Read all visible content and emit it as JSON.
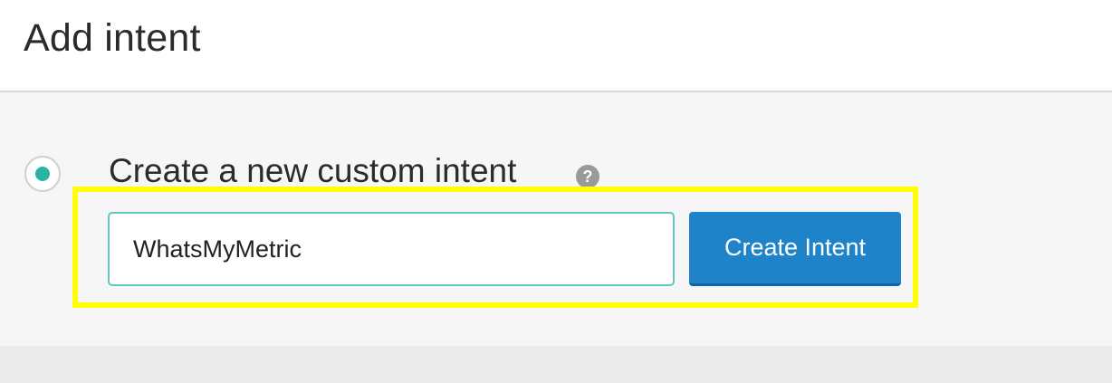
{
  "header": {
    "title": "Add intent"
  },
  "intent_option": {
    "label": "Create a new custom intent",
    "selected": true,
    "help_icon": "?"
  },
  "form": {
    "intent_name_value": "WhatsMyMetric",
    "create_button_label": "Create Intent"
  },
  "colors": {
    "accent": "#2bb3a5",
    "button": "#1f83c9",
    "highlight": "#ffff00"
  }
}
